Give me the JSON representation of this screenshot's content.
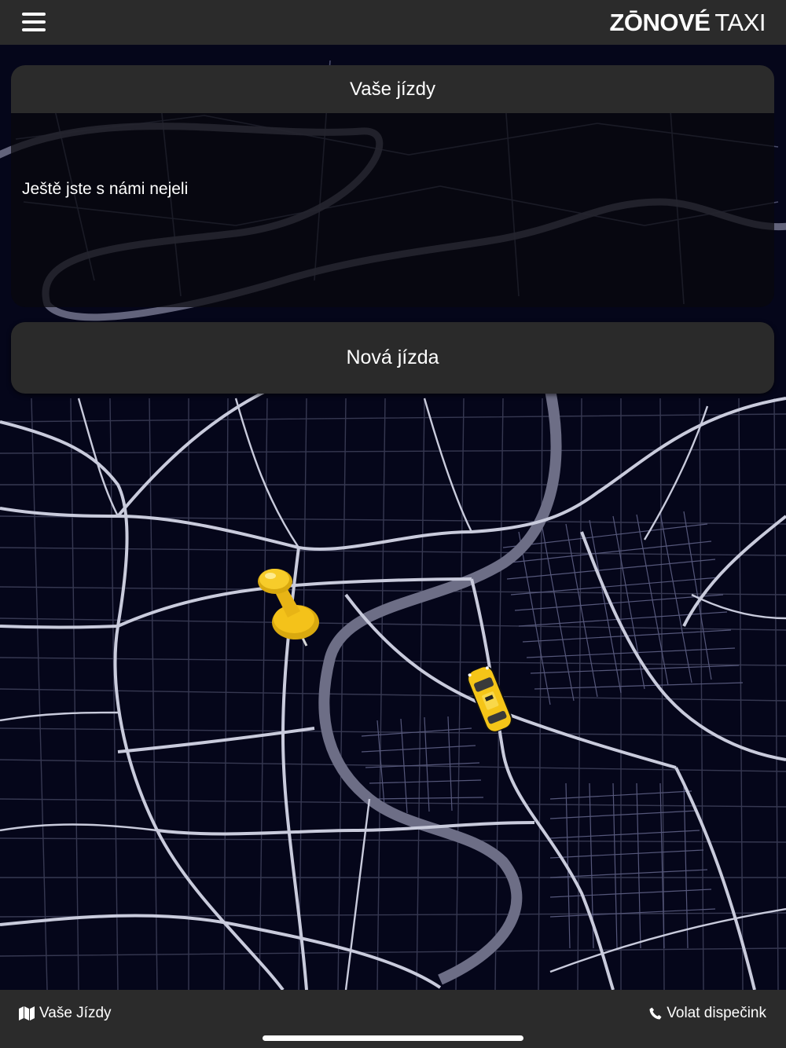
{
  "header": {
    "brand_bold": "ZŌNOVÉ",
    "brand_light": "TAXI",
    "menu_icon": "hamburger-menu-icon"
  },
  "rides": {
    "title": "Vaše jízdy",
    "empty_text": "Ještě jste s námi nejeli"
  },
  "new_ride": {
    "label": "Nová jízda"
  },
  "map": {
    "background_color": "#05061a",
    "road_color": "#c9cbdc",
    "river_color": "#6d6e86",
    "pin_icon": "pushpin-icon",
    "car_icon": "taxi-car-icon",
    "marker_color": "#f4c21a"
  },
  "bottom_bar": {
    "left_icon": "map-icon",
    "left_label": "Vaše Jízdy",
    "right_icon": "phone-icon",
    "right_label": "Volat dispečink"
  }
}
